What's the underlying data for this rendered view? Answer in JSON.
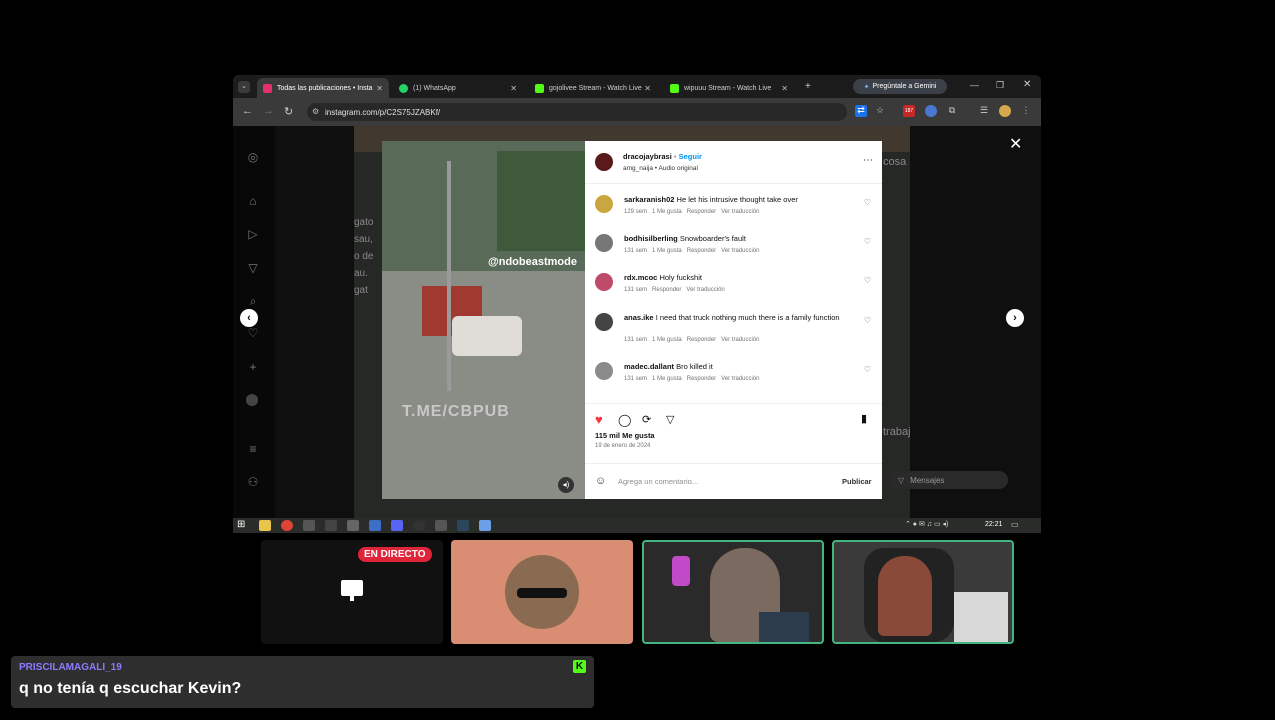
{
  "browser": {
    "tabs": [
      {
        "label": "Todas las publicaciones • Insta",
        "color": "#e1306c"
      },
      {
        "label": "(1) WhatsApp",
        "color": "#25d366"
      },
      {
        "label": "gojolivee Stream - Watch Live",
        "color": "#53fc18"
      },
      {
        "label": "wipuuu Stream - Watch Live",
        "color": "#53fc18"
      }
    ],
    "new_tab": "+",
    "gemini_label": "Pregúntale a Gemini",
    "url": "instagram.com/p/C2S75JZABKf/",
    "badge": "187"
  },
  "post": {
    "author": "dracojaybrasi",
    "follow": "Seguir",
    "audio": "amg_naija • Audio original",
    "comments": [
      {
        "user": "sarkaranish02",
        "text": "He let his intrusive thought take over",
        "meta": [
          "129 sem",
          "1 Me gusta",
          "Responder",
          "Ver traducción"
        ]
      },
      {
        "user": "bodhisilberling",
        "text": "Snowboarder's fault",
        "meta": [
          "131 sem",
          "1 Me gusta",
          "Responder",
          "Ver traducción"
        ]
      },
      {
        "user": "rdx.mcoc",
        "text": "Holy fuckshit",
        "meta": [
          "131 sem",
          "Responder",
          "Ver traducción"
        ]
      },
      {
        "user": "anas.ike",
        "text": "I need that truck nothing much there is a family function",
        "meta": [
          "131 sem",
          "1 Me gusta",
          "Responder",
          "Ver traducción"
        ]
      },
      {
        "user": "madec.dallant",
        "text": "Bro killed it",
        "meta": [
          "131 sem",
          "1 Me gusta",
          "Responder",
          "Ver traducción"
        ]
      }
    ],
    "likes": "115 mil Me gusta",
    "date": "19 de enero de 2024",
    "comment_placeholder": "Agrega un comentario...",
    "publish": "Publicar",
    "video_watermark_top": "@ndobeastmode",
    "video_watermark_bottom": "T.ME/CBPUB"
  },
  "background": {
    "left_snippets": [
      "gato",
      "sau,",
      "o de",
      "au.",
      "gat"
    ],
    "right_snippet_1": "cosa",
    "right_snippet_2": "trabaj",
    "messages": "Mensajes"
  },
  "taskbar": {
    "time": "22:21"
  },
  "call": {
    "live_badge": "EN DIRECTO"
  },
  "chat": {
    "username": "PRISCILAMAGALI_19",
    "message": "q no tenía q escuchar Kevin?",
    "badge": "K",
    "username_color": "#8b7cff",
    "badge_color": "#53fc18"
  }
}
